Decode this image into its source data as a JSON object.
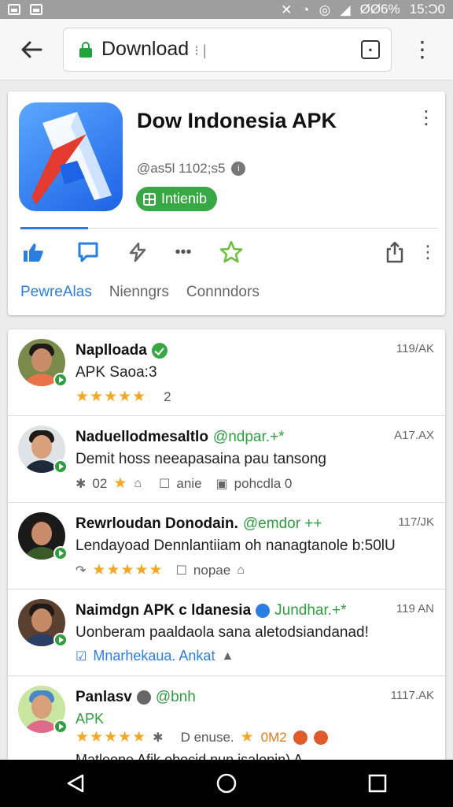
{
  "status_bar": {
    "battery": "ØØ6%",
    "time": "15:Ɔ0"
  },
  "url_bar": {
    "url": "Download",
    "cursor": "⁝  |"
  },
  "app": {
    "title": "Dow Indonesia APK",
    "subtitle": "@as5l 1102;s5",
    "install_label": "Intienib"
  },
  "tabs": [
    "PewreAlas",
    "Nienngrs",
    "Connndors"
  ],
  "reviews": [
    {
      "name": "Naplloada",
      "handle": "",
      "time": "119/AK",
      "text": "APK Saoa:3",
      "meta_after_stars": "2"
    },
    {
      "name": "Naduellodmesaltlo",
      "handle": "@ndpar.+*",
      "time": "A17.AX",
      "text": "Demit hoss neeapasaina pau tansong",
      "meta_prefix": "02",
      "meta_b": "anie",
      "meta_c": "pohcdla 0"
    },
    {
      "name": "Rewrloudan Donodain.",
      "handle": "@emdor ++",
      "time": "117/JK",
      "text": "Lendayoad Dennlantiiam oh nanagtanole b:50lU",
      "meta_b": "nopae"
    },
    {
      "name": "Naimdgn APK c ldanesia",
      "handle": "Jundhar.+*",
      "time": "119 AN",
      "text": "Uonberam paaldaola sana aletodsiandanad!",
      "link": "Mnarhekaua. Ankat"
    },
    {
      "name": "Panlasv",
      "handle": "@bnh",
      "time": "1117.AK",
      "text": "APK",
      "meta_b": "D enuse.",
      "meta_c": "0M2",
      "more": "Matleone Afik obocid nun isalopin) A"
    }
  ],
  "colors": {
    "accent_blue": "#2a7de1",
    "accent_green": "#37a844",
    "star": "#f5a623"
  }
}
